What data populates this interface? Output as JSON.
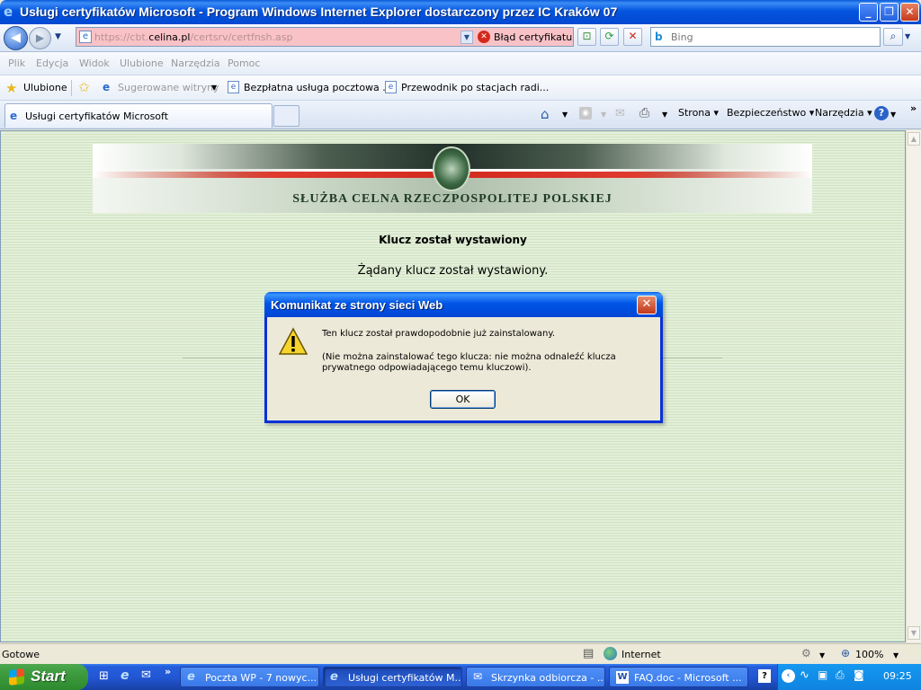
{
  "window": {
    "title": "Usługi certyfikatów Microsoft - Program Windows Internet Explorer dostarczony przez IC Kraków 07"
  },
  "nav": {
    "url_prefix": "https://cbt.",
    "url_domain": "celina.pl",
    "url_path": "/certsrv/certfnsh.asp",
    "cert_error": "Błąd certyfikatu",
    "search_placeholder": "Bing"
  },
  "menu": [
    "Plik",
    "Edycja",
    "Widok",
    "Ulubione",
    "Narzędzia",
    "Pomoc"
  ],
  "favorites": {
    "label": "Ulubione",
    "items": [
      "Sugerowane witryny",
      "Bezpłatna usługa pocztowa ...",
      "Przewodnik po stacjach radi..."
    ]
  },
  "tab": {
    "label": "Usługi certyfikatów Microsoft"
  },
  "commands": {
    "page": "Strona",
    "security": "Bezpieczeństwo",
    "tools": "Narzędzia"
  },
  "page": {
    "banner_text": "SŁUŻBA CELNA RZECZPOSPOLITEJ POLSKIEJ",
    "heading": "Klucz został wystawiony",
    "message": "Żądany klucz został wystawiony."
  },
  "dialog": {
    "title": "Komunikat ze strony sieci Web",
    "line1": "Ten klucz został prawdopodobnie już zainstalowany.",
    "line2": "(Nie można zainstalować tego klucza: nie można odnaleźć klucza prywatnego odpowiadającego temu kluczowi).",
    "ok": "OK"
  },
  "status": {
    "text": "Gotowe",
    "zone": "Internet",
    "zoom": "100%"
  },
  "taskbar": {
    "start": "Start",
    "tasks": [
      "Poczta WP - 7 nowyc...",
      "Usługi certyfikatów M...",
      "Skrzynka odbiorcza - ...",
      "FAQ.doc - Microsoft ..."
    ],
    "clock": "09:25"
  },
  "colors": {
    "titlebar": "#0454e0",
    "address_error_bg": "#f9c2c7",
    "page_bg": "#d9e8cd",
    "banner_red": "#d2291f"
  }
}
